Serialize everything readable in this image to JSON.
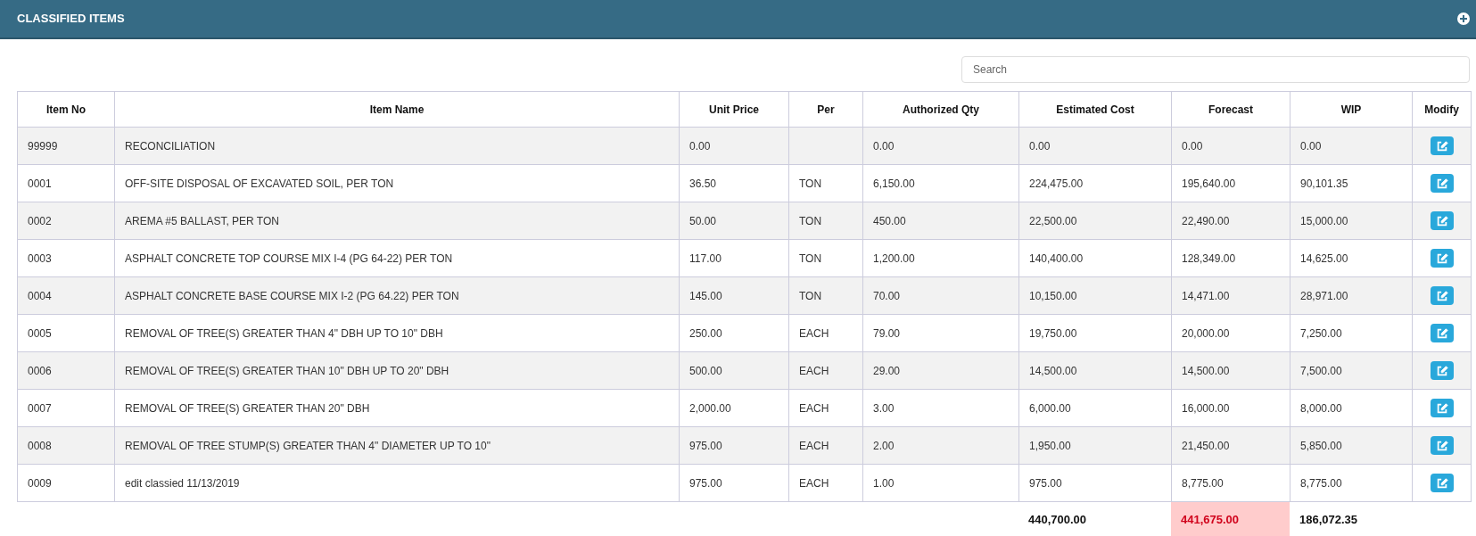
{
  "panel": {
    "title": "CLASSIFIED ITEMS"
  },
  "search": {
    "placeholder": "Search"
  },
  "table": {
    "columns": [
      "Item No",
      "Item Name",
      "Unit Price",
      "Per",
      "Authorized Qty",
      "Estimated Cost",
      "Forecast",
      "WIP",
      "Modify"
    ],
    "rows": [
      {
        "item_no": "99999",
        "item_name": "RECONCILIATION",
        "unit_price": "0.00",
        "per": "",
        "authorized_qty": "0.00",
        "estimated_cost": "0.00",
        "forecast": "0.00",
        "wip": "0.00"
      },
      {
        "item_no": "0001",
        "item_name": "OFF-SITE DISPOSAL OF EXCAVATED SOIL, PER TON",
        "unit_price": "36.50",
        "per": "TON",
        "authorized_qty": "6,150.00",
        "estimated_cost": "224,475.00",
        "forecast": "195,640.00",
        "wip": "90,101.35"
      },
      {
        "item_no": "0002",
        "item_name": "AREMA #5 BALLAST, PER TON",
        "unit_price": "50.00",
        "per": "TON",
        "authorized_qty": "450.00",
        "estimated_cost": "22,500.00",
        "forecast": "22,490.00",
        "wip": "15,000.00"
      },
      {
        "item_no": "0003",
        "item_name": "ASPHALT CONCRETE TOP COURSE MIX I-4 (PG 64-22) PER TON",
        "unit_price": "117.00",
        "per": "TON",
        "authorized_qty": "1,200.00",
        "estimated_cost": "140,400.00",
        "forecast": "128,349.00",
        "wip": "14,625.00"
      },
      {
        "item_no": "0004",
        "item_name": "ASPHALT CONCRETE BASE COURSE MIX I-2 (PG 64.22) PER TON",
        "unit_price": "145.00",
        "per": "TON",
        "authorized_qty": "70.00",
        "estimated_cost": "10,150.00",
        "forecast": "14,471.00",
        "wip": "28,971.00"
      },
      {
        "item_no": "0005",
        "item_name": "REMOVAL OF TREE(S) GREATER THAN 4\" DBH UP TO 10\" DBH",
        "unit_price": "250.00",
        "per": "EACH",
        "authorized_qty": "79.00",
        "estimated_cost": "19,750.00",
        "forecast": "20,000.00",
        "wip": "7,250.00"
      },
      {
        "item_no": "0006",
        "item_name": "REMOVAL OF TREE(S) GREATER THAN 10\" DBH UP TO 20\" DBH",
        "unit_price": "500.00",
        "per": "EACH",
        "authorized_qty": "29.00",
        "estimated_cost": "14,500.00",
        "forecast": "14,500.00",
        "wip": "7,500.00"
      },
      {
        "item_no": "0007",
        "item_name": "REMOVAL OF TREE(S) GREATER THAN 20\" DBH",
        "unit_price": "2,000.00",
        "per": "EACH",
        "authorized_qty": "3.00",
        "estimated_cost": "6,000.00",
        "forecast": "16,000.00",
        "wip": "8,000.00"
      },
      {
        "item_no": "0008",
        "item_name": "REMOVAL OF TREE STUMP(S) GREATER THAN 4\" DIAMETER UP TO 10\"",
        "unit_price": "975.00",
        "per": "EACH",
        "authorized_qty": "2.00",
        "estimated_cost": "1,950.00",
        "forecast": "21,450.00",
        "wip": "5,850.00"
      },
      {
        "item_no": "0009",
        "item_name": "edit classied 11/13/2019",
        "unit_price": "975.00",
        "per": "EACH",
        "authorized_qty": "1.00",
        "estimated_cost": "975.00",
        "forecast": "8,775.00",
        "wip": "8,775.00"
      }
    ],
    "totals": {
      "estimated_cost": "440,700.00",
      "forecast": "441,675.00",
      "forecast_over": true,
      "wip": "186,072.35"
    }
  }
}
